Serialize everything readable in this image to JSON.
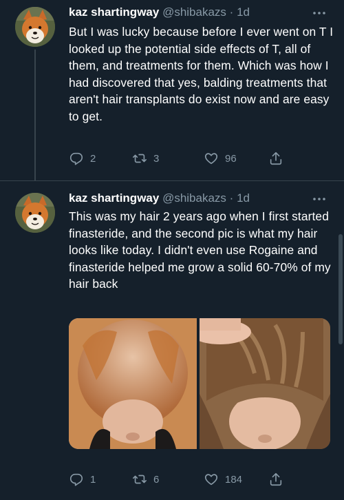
{
  "tweets": [
    {
      "author_name": "kaz shartingway",
      "author_handle": "@shibakazs",
      "separator": "·",
      "time": "1d",
      "text": "But I was lucky because before I ever went on T I looked up the potential side effects of T, all of them, and treatments for them. Which was how I had discovered that yes, balding treatments that aren't hair transplants do exist now and are easy to get.",
      "replies": "2",
      "retweets": "3",
      "likes": "96"
    },
    {
      "author_name": "kaz shartingway",
      "author_handle": "@shibakazs",
      "separator": "·",
      "time": "1d",
      "text": "This was my hair 2 years ago when I first started finasteride, and the second pic is what my hair looks like today. I didn't even use Rogaine and finasteride helped me grow a solid 60-70% of my hair back",
      "replies": "1",
      "retweets": "6",
      "likes": "184"
    }
  ],
  "icons": {
    "more": "more-icon",
    "reply": "reply-icon",
    "retweet": "retweet-icon",
    "like": "heart-icon",
    "share": "share-icon"
  },
  "colors": {
    "background": "#15202b",
    "secondary_text": "#8899a6",
    "divider": "#38444d"
  }
}
